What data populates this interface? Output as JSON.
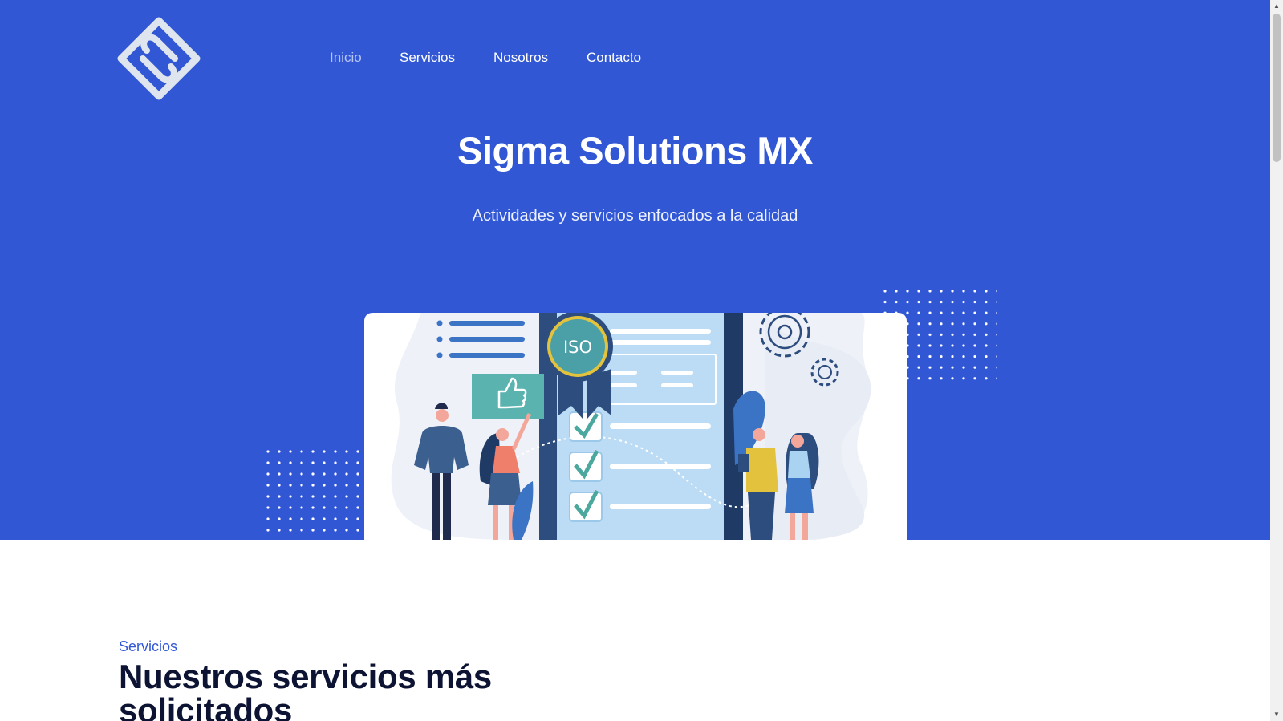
{
  "brand": {
    "logo_icon": "sigma-diamond-logo-icon"
  },
  "nav": {
    "items": [
      {
        "label": "Inicio",
        "active": true
      },
      {
        "label": "Servicios",
        "active": false
      },
      {
        "label": "Nosotros",
        "active": false
      },
      {
        "label": "Contacto",
        "active": false
      }
    ]
  },
  "hero": {
    "title": "Sigma Solutions MX",
    "subtitle": "Actividades y servicios enfocados a la calidad",
    "badge_text": "ISO",
    "illustration_icon": "iso-quality-checklist-illustration"
  },
  "services": {
    "kicker": "Servicios",
    "title": "Nuestros servicios más solicitados"
  },
  "colors": {
    "primary": "#3157d5",
    "nav_active": "#b8c6f4",
    "heading_dark": "#0d1433",
    "badge_teal": "#4b9fa6",
    "badge_gold": "#e3c23d"
  }
}
